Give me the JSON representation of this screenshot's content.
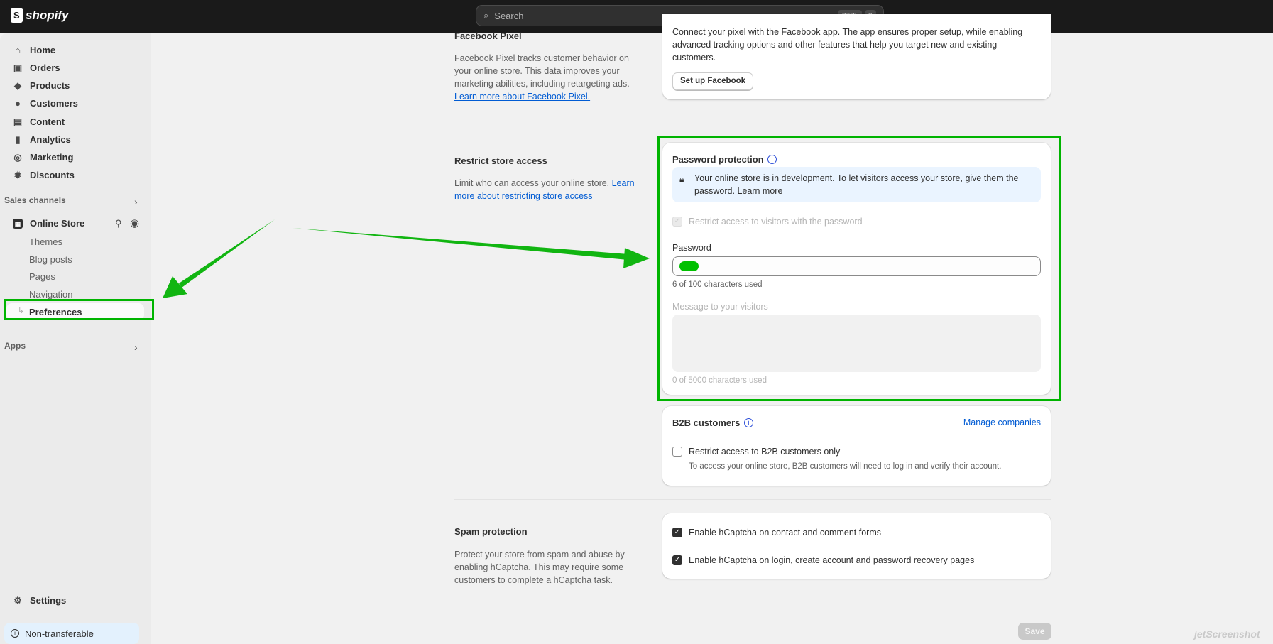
{
  "topbar": {
    "brand": "shopify",
    "search_placeholder": "Search",
    "shortcut": [
      "CTRL",
      "K"
    ]
  },
  "sidebar": {
    "items": [
      {
        "label": "Home",
        "icon": "home-icon"
      },
      {
        "label": "Orders",
        "icon": "inbox-icon"
      },
      {
        "label": "Products",
        "icon": "tag-icon"
      },
      {
        "label": "Customers",
        "icon": "person-icon"
      },
      {
        "label": "Content",
        "icon": "content-icon"
      },
      {
        "label": "Analytics",
        "icon": "bar-chart-icon"
      },
      {
        "label": "Marketing",
        "icon": "target-icon"
      },
      {
        "label": "Discounts",
        "icon": "discount-icon"
      }
    ],
    "sales_channels": "Sales channels",
    "online_store": "Online Store",
    "sub_items": [
      "Themes",
      "Blog posts",
      "Pages",
      "Navigation",
      "Preferences"
    ],
    "apps": "Apps",
    "settings": "Settings",
    "non_transferable": "Non-transferable"
  },
  "facebook": {
    "title": "Facebook Pixel",
    "desc": "Facebook Pixel tracks customer behavior on your online store. This data improves your marketing abilities, including retargeting ads.",
    "link": "Learn more about Facebook Pixel.",
    "card_text": "Connect your pixel with the Facebook app. The app ensures proper setup, while enabling advanced tracking options and other features that help you target new and existing customers.",
    "button": "Set up Facebook"
  },
  "restrict": {
    "title": "Restrict store access",
    "desc": "Limit who can access your online store.",
    "link": "Learn more about restricting store access"
  },
  "password": {
    "title": "Password protection",
    "banner": "Your online store is in development. To let visitors access your store, give them the password.",
    "banner_link": "Learn more",
    "checkbox": "Restrict access to visitors with the password",
    "label": "Password",
    "count": "6 of 100 characters used",
    "message_label": "Message to your visitors",
    "message_count": "0 of 5000 characters used"
  },
  "b2b": {
    "title": "B2B customers",
    "manage": "Manage companies",
    "checkbox": "Restrict access to B2B customers only",
    "help": "To access your online store, B2B customers will need to log in and verify their account."
  },
  "spam": {
    "title": "Spam protection",
    "desc": "Protect your store from spam and abuse by enabling hCaptcha. This may require some customers to complete a hCaptcha task.",
    "options": [
      "Enable hCaptcha on contact and comment forms",
      "Enable hCaptcha on login, create account and password recovery pages"
    ]
  },
  "save": "Save",
  "watermark": "jetScreenshot"
}
